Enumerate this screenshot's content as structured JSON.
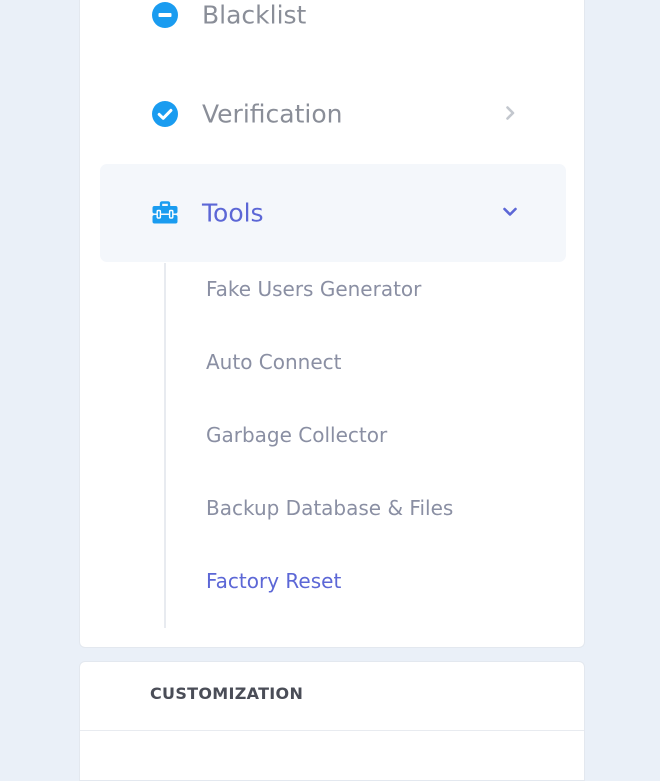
{
  "menu": {
    "items": [
      {
        "label": "Blacklist",
        "icon": "minus-circle-icon"
      },
      {
        "label": "Verification",
        "icon": "check-circle-icon"
      },
      {
        "label": "Tools",
        "icon": "toolbox-icon",
        "expanded": true
      }
    ],
    "tools_submenu": [
      {
        "label": "Fake Users Generator"
      },
      {
        "label": "Auto Connect"
      },
      {
        "label": "Garbage Collector"
      },
      {
        "label": "Backup Database & Files"
      },
      {
        "label": "Factory Reset",
        "active": true
      }
    ]
  },
  "customization": {
    "title": "CUSTOMIZATION"
  },
  "colors": {
    "page_bg": "#eaf0f8",
    "card_bg": "#ffffff",
    "icon_blue": "#1a9cf0",
    "accent": "#5c67d6",
    "text_muted": "#8a8e98",
    "submenu_text": "#8a8fa3",
    "active_row_bg": "#f4f7fb"
  }
}
